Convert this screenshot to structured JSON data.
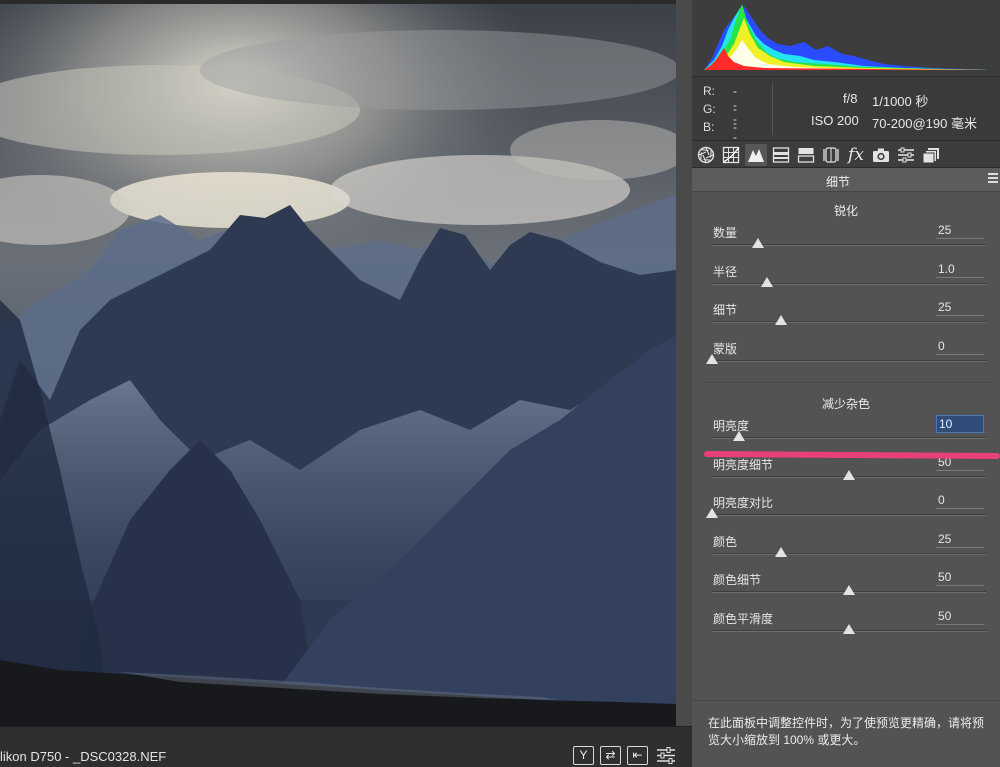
{
  "file": {
    "name": "likon D750 -  _DSC0328.NEF"
  },
  "statusbar": {
    "buttons": [
      {
        "icon": "y-compare-icon",
        "glyph": "Y"
      },
      {
        "icon": "swap-icon",
        "glyph": "⇄"
      },
      {
        "icon": "copy-settings-icon",
        "glyph": "⇤"
      },
      {
        "icon": "preview-settings-icon",
        "glyph": "≡"
      }
    ]
  },
  "histogram": {
    "colors": {
      "red": "#ff2a2a",
      "green": "#27e34a",
      "blue": "#2b4bff",
      "yellow": "#f0f028",
      "cyan": "#22e5f0",
      "white": "#ffffff"
    }
  },
  "readout": {
    "r_label": "R:",
    "r_value": "---",
    "g_label": "G:",
    "g_value": "---",
    "b_label": "B:",
    "b_value": "---"
  },
  "exif": {
    "aperture": "f/8",
    "shutter": "1/1000 秒",
    "iso": "ISO 200",
    "lens": "70-200@190 毫米"
  },
  "tabs": [
    {
      "icon": "aperture-icon",
      "active": false
    },
    {
      "icon": "tone-curve-grid-icon",
      "active": false
    },
    {
      "icon": "detail-mountain-icon",
      "active": true
    },
    {
      "icon": "hsl-icon",
      "active": false
    },
    {
      "icon": "split-toning-icon",
      "active": false
    },
    {
      "icon": "lens-correction-icon",
      "active": false
    },
    {
      "icon": "fx-icon",
      "active": false
    },
    {
      "icon": "camera-calibration-icon",
      "active": false
    },
    {
      "icon": "presets-icon",
      "active": false
    },
    {
      "icon": "snapshots-icon",
      "active": false
    }
  ],
  "panel": {
    "title": "细节"
  },
  "sharpening": {
    "title": "锐化",
    "sliders": [
      {
        "label": "数量",
        "value": "25",
        "min": 0,
        "max": 150,
        "level": 25
      },
      {
        "label": "半径",
        "value": "1.0",
        "min": 0.5,
        "max": 3.0,
        "level": 1.0
      },
      {
        "label": "细节",
        "value": "25",
        "min": 0,
        "max": 100,
        "level": 25
      },
      {
        "label": "蒙版",
        "value": "0",
        "min": 0,
        "max": 100,
        "level": 0
      }
    ]
  },
  "noise_reduction": {
    "title": "减少杂色",
    "sliders": [
      {
        "label": "明亮度",
        "value": "10",
        "min": 0,
        "max": 100,
        "level": 10,
        "focused": true
      },
      {
        "label": "明亮度细节",
        "value": "50",
        "min": 0,
        "max": 100,
        "level": 50
      },
      {
        "label": "明亮度对比",
        "value": "0",
        "min": 0,
        "max": 100,
        "level": 0
      },
      {
        "label": "颜色",
        "value": "25",
        "min": 0,
        "max": 100,
        "level": 25
      },
      {
        "label": "颜色细节",
        "value": "50",
        "min": 0,
        "max": 100,
        "level": 50
      },
      {
        "label": "颜色平滑度",
        "value": "50",
        "min": 0,
        "max": 100,
        "level": 50
      }
    ]
  },
  "footer": {
    "note": "在此面板中调整控件时，为了使预览更精确，请将预览大小缩放到 100% 或更大。"
  }
}
